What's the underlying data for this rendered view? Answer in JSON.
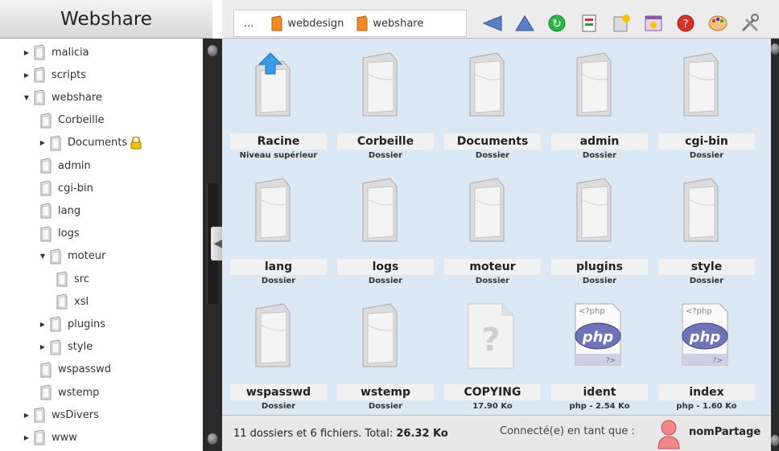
{
  "app": {
    "title": "Webshare"
  },
  "tree": [
    {
      "label": "malicia",
      "depth": 0,
      "expander": "collapsed"
    },
    {
      "label": "scripts",
      "depth": 0,
      "expander": "collapsed"
    },
    {
      "label": "webshare",
      "depth": 0,
      "expander": "expanded"
    },
    {
      "label": "Corbeille",
      "depth": 1,
      "expander": "none"
    },
    {
      "label": "Documents",
      "depth": 1,
      "expander": "collapsed",
      "locked": true
    },
    {
      "label": "admin",
      "depth": 1,
      "expander": "none"
    },
    {
      "label": "cgi-bin",
      "depth": 1,
      "expander": "none"
    },
    {
      "label": "lang",
      "depth": 1,
      "expander": "none"
    },
    {
      "label": "logs",
      "depth": 1,
      "expander": "none"
    },
    {
      "label": "moteur",
      "depth": 1,
      "expander": "expanded"
    },
    {
      "label": "src",
      "depth": 2,
      "expander": "none"
    },
    {
      "label": "xsl",
      "depth": 2,
      "expander": "none"
    },
    {
      "label": "plugins",
      "depth": 1,
      "expander": "collapsed"
    },
    {
      "label": "style",
      "depth": 1,
      "expander": "collapsed"
    },
    {
      "label": "wspasswd",
      "depth": 1,
      "expander": "none"
    },
    {
      "label": "wstemp",
      "depth": 1,
      "expander": "none"
    },
    {
      "label": "wsDivers",
      "depth": 0,
      "expander": "collapsed"
    },
    {
      "label": "www",
      "depth": 0,
      "expander": "collapsed"
    }
  ],
  "breadcrumb": {
    "ellipsis": "...",
    "items": [
      "webdesign",
      "webshare"
    ]
  },
  "toolbar": {
    "tools": [
      {
        "icon": "back-arrow-icon"
      },
      {
        "icon": "up-arrow-icon"
      },
      {
        "icon": "refresh-icon"
      },
      {
        "icon": "sort-icon"
      },
      {
        "icon": "new-file-icon"
      },
      {
        "icon": "new-window-icon"
      },
      {
        "icon": "help-icon"
      },
      {
        "icon": "palette-icon"
      },
      {
        "icon": "settings-tools-icon"
      }
    ]
  },
  "files": [
    {
      "name": "Racine",
      "sub": "Niveau supérieur",
      "kind": "parent"
    },
    {
      "name": "Corbeille",
      "sub": "Dossier",
      "kind": "folder"
    },
    {
      "name": "Documents",
      "sub": "Dossier",
      "kind": "folder"
    },
    {
      "name": "admin",
      "sub": "Dossier",
      "kind": "folder"
    },
    {
      "name": "cgi-bin",
      "sub": "Dossier",
      "kind": "folder"
    },
    {
      "name": "lang",
      "sub": "Dossier",
      "kind": "folder"
    },
    {
      "name": "logs",
      "sub": "Dossier",
      "kind": "folder"
    },
    {
      "name": "moteur",
      "sub": "Dossier",
      "kind": "folder"
    },
    {
      "name": "plugins",
      "sub": "Dossier",
      "kind": "folder"
    },
    {
      "name": "style",
      "sub": "Dossier",
      "kind": "folder"
    },
    {
      "name": "wspasswd",
      "sub": "Dossier",
      "kind": "folder"
    },
    {
      "name": "wstemp",
      "sub": "Dossier",
      "kind": "folder"
    },
    {
      "name": "COPYING",
      "sub": "17.90 Ko",
      "kind": "unknown"
    },
    {
      "name": "ident",
      "sub": "php - 2.54 Ko",
      "kind": "php"
    },
    {
      "name": "index",
      "sub": "php - 1.60 Ko",
      "kind": "php"
    }
  ],
  "php_icon_text": {
    "open": "<?php",
    "logo": "php",
    "close": "?>"
  },
  "status": {
    "folders_count": "11",
    "folders_label": " dossiers et ",
    "files_count": "6",
    "files_label": " fichiers. Total: ",
    "total_size": "26.32 Ko",
    "connected_label": "Connecté(e) en tant que :",
    "username": "nomPartage"
  },
  "colors": {
    "main_bg": "#dce8f3",
    "splitter": "#2a2a2a",
    "toolbar_bg": "#ececec"
  }
}
